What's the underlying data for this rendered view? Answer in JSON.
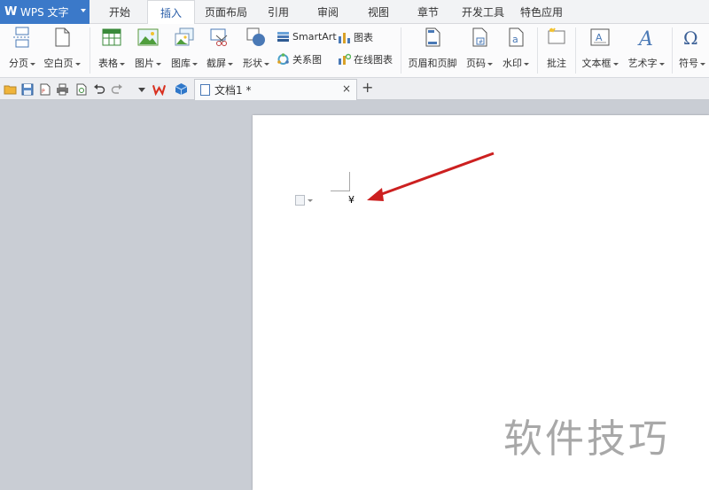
{
  "app": {
    "name": "WPS 文字"
  },
  "menu_tabs": [
    {
      "label": "开始",
      "active": false
    },
    {
      "label": "插入",
      "active": true
    },
    {
      "label": "页面布局",
      "active": false
    },
    {
      "label": "引用",
      "active": false
    },
    {
      "label": "审阅",
      "active": false
    },
    {
      "label": "视图",
      "active": false
    },
    {
      "label": "章节",
      "active": false
    },
    {
      "label": "开发工具",
      "active": false
    },
    {
      "label": "特色应用",
      "active": false
    }
  ],
  "ribbon": {
    "page_break": "分页",
    "blank_page": "空白页",
    "table": "表格",
    "picture": "图片",
    "gallery": "图库",
    "screenshot": "截屏",
    "shape": "形状",
    "smartart": "SmartArt",
    "chart": "图表",
    "relation": "关系图",
    "online_chart": "在线图表",
    "header_footer": "页眉和页脚",
    "page_number": "页码",
    "watermark": "水印",
    "comment": "批注",
    "textbox": "文本框",
    "wordart": "艺术字",
    "symbol": "符号"
  },
  "document": {
    "tab_title": "文档1 *",
    "close_glyph": "×",
    "new_tab_glyph": "+",
    "content_symbol": "¥"
  },
  "overlay_watermark": "软件技巧",
  "colors": {
    "brand_blue": "#3b79c9",
    "annotation_arrow": "#cc2020",
    "workspace_bg": "#c9cdd4"
  }
}
